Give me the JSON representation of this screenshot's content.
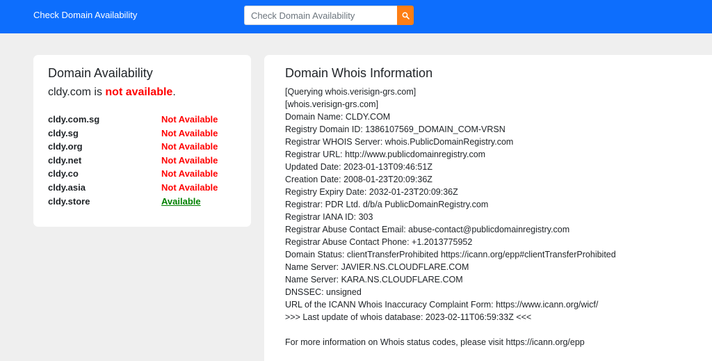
{
  "navbar": {
    "brand": "Check Domain Availability",
    "search_placeholder": "Check Domain Availability",
    "search_value": "",
    "accent_color": "#0d6efd",
    "search_button_color": "#fd7e14",
    "search_icon": "search-icon"
  },
  "availability": {
    "title": "Domain Availability",
    "queried_domain": "cldy.com",
    "status_connector": " is ",
    "status_text": "not available",
    "status_end": ".",
    "domains": [
      {
        "name": "cldy.com.sg",
        "status": "Not Available",
        "available": false
      },
      {
        "name": "cldy.sg",
        "status": "Not Available",
        "available": false
      },
      {
        "name": "cldy.org",
        "status": "Not Available",
        "available": false
      },
      {
        "name": "cldy.net",
        "status": "Not Available",
        "available": false
      },
      {
        "name": "cldy.co",
        "status": "Not Available",
        "available": false
      },
      {
        "name": "cldy.asia",
        "status": "Not Available",
        "available": false
      },
      {
        "name": "cldy.store",
        "status": "Available",
        "available": true
      }
    ],
    "not_available_color": "#ff0000",
    "available_color": "#008000"
  },
  "whois": {
    "title": "Domain Whois Information",
    "lines": [
      "[Querying whois.verisign-grs.com]",
      "[whois.verisign-grs.com]",
      "Domain Name: CLDY.COM",
      "Registry Domain ID: 1386107569_DOMAIN_COM-VRSN",
      "Registrar WHOIS Server: whois.PublicDomainRegistry.com",
      "Registrar URL: http://www.publicdomainregistry.com",
      "Updated Date: 2023-01-13T09:46:51Z",
      "Creation Date: 2008-01-23T20:09:36Z",
      "Registry Expiry Date: 2032-01-23T20:09:36Z",
      "Registrar: PDR Ltd. d/b/a PublicDomainRegistry.com",
      "Registrar IANA ID: 303",
      "Registrar Abuse Contact Email: abuse-contact@publicdomainregistry.com",
      "Registrar Abuse Contact Phone: +1.2013775952",
      "Domain Status: clientTransferProhibited https://icann.org/epp#clientTransferProhibited",
      "Name Server: JAVIER.NS.CLOUDFLARE.COM",
      "Name Server: KARA.NS.CLOUDFLARE.COM",
      "DNSSEC: unsigned",
      "URL of the ICANN Whois Inaccuracy Complaint Form: https://www.icann.org/wicf/",
      ">>> Last update of whois database: 2023-02-11T06:59:33Z <<<",
      "",
      "For more information on Whois status codes, please visit https://icann.org/epp"
    ]
  }
}
